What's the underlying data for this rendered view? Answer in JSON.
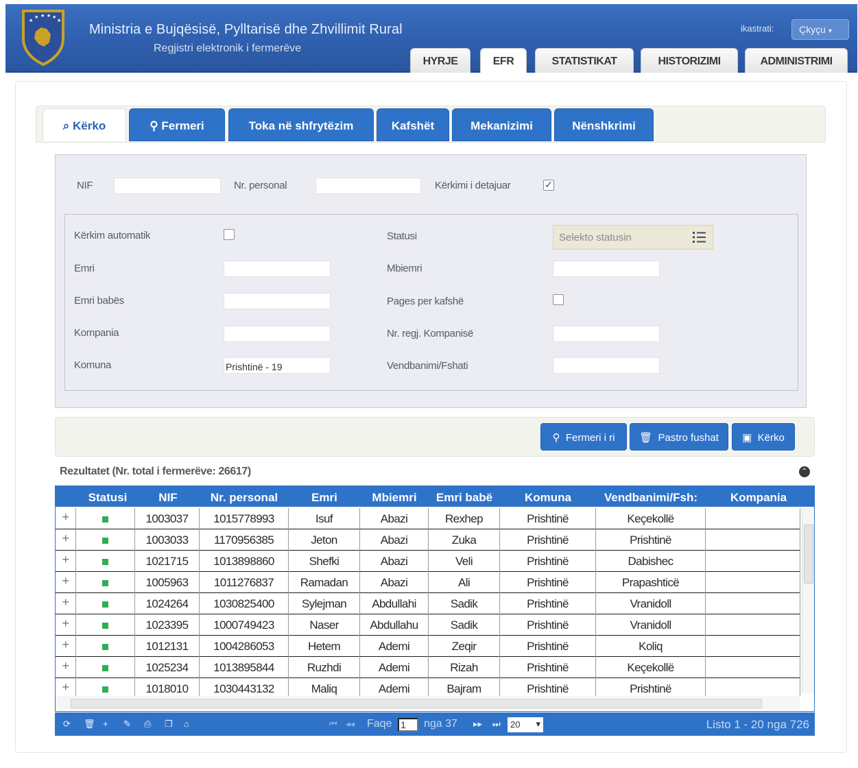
{
  "header": {
    "title": "Ministria e Bujqësisë, Pylltarisë dhe Zhvillimit Rural",
    "subtitle": "Regjistri elektronik i fermerëve",
    "user": "ikastrati:",
    "logout": "Çkyçu"
  },
  "main_tabs": [
    {
      "label": "HYRJE"
    },
    {
      "label": "EFR"
    },
    {
      "label": "STATISTIKAT"
    },
    {
      "label": "HISTORIZIMI"
    },
    {
      "label": "ADMINISTRIMI"
    }
  ],
  "sub_tabs": [
    {
      "label": "Kërko"
    },
    {
      "label": "Fermeri"
    },
    {
      "label": "Toka në shfrytëzim"
    },
    {
      "label": "Kafshët"
    },
    {
      "label": "Mekanizimi"
    },
    {
      "label": "Nënshkrimi"
    }
  ],
  "search": {
    "nif_label": "NIF",
    "nif_value": "",
    "personal_label": "Nr. personal",
    "personal_value": "",
    "detailed_label": "Kërkimi i detajuar",
    "detailed_checked": true,
    "auto_label": "Kërkim automatik",
    "auto_checked": false,
    "status_label": "Statusi",
    "status_placeholder": "Selekto statusin",
    "name_label": "Emri",
    "surname_label": "Mbiemri",
    "father_label": "Emri babës",
    "animal_pay_label": "Pages per kafshë",
    "animal_pay_checked": false,
    "company_label": "Kompania",
    "company_reg_label": "Nr. regj. Kompanisë",
    "municipality_label": "Komuna",
    "municipality_value": "Prishtinë - 19",
    "village_label": "Vendbanimi/Fshati"
  },
  "actions": {
    "new_farmer": "Fermeri i ri",
    "clear": "Pastro fushat",
    "search": "Kërko"
  },
  "results": {
    "title": "Rezultatet (Nr. total i fermerëve: 26617)",
    "columns": [
      "Statusi",
      "NIF",
      "Nr. personal",
      "Emri",
      "Mbiemri",
      "Emri babë",
      "Komuna",
      "Vendbanimi/Fsh:",
      "Kompania"
    ],
    "rows": [
      [
        "1003037",
        "1015778993",
        "Isuf",
        "Abazi",
        "Rexhep",
        "Prishtinë",
        "Keçekollë",
        ""
      ],
      [
        "1003033",
        "1170956385",
        "Jeton",
        "Abazi",
        "Zuka",
        "Prishtinë",
        "Prishtinë",
        ""
      ],
      [
        "1021715",
        "1013898860",
        "Shefki",
        "Abazi",
        "Veli",
        "Prishtinë",
        "Dabishec",
        ""
      ],
      [
        "1005963",
        "1011276837",
        "Ramadan",
        "Abazi",
        "Ali",
        "Prishtinë",
        "Prapashticë",
        ""
      ],
      [
        "1024264",
        "1030825400",
        "Sylejman",
        "Abdullahi",
        "Sadik",
        "Prishtinë",
        "Vranidoll",
        ""
      ],
      [
        "1023395",
        "1000749423",
        "Naser",
        "Abdullahu",
        "Sadik",
        "Prishtinë",
        "Vranidoll",
        ""
      ],
      [
        "1012131",
        "1004286053",
        "Hetem",
        "Ademi",
        "Zeqir",
        "Prishtinë",
        "Koliq",
        ""
      ],
      [
        "1025234",
        "1013895844",
        "Ruzhdi",
        "Ademi",
        "Rizah",
        "Prishtinë",
        "Keçekollë",
        ""
      ],
      [
        "1018010",
        "1030443132",
        "Maliq",
        "Ademi",
        "Bajram",
        "Prishtinë",
        "Prishtinë",
        ""
      ]
    ],
    "status_color": "#2fae55"
  },
  "pager": {
    "page_label": "Faqe",
    "page_value": "1",
    "of_label": "nga 37",
    "page_size": "20",
    "info": "Listo 1 - 20 nga 726"
  },
  "colors": {
    "header_blue": "#2f5fae",
    "accent_blue": "#2f73c9",
    "panel_bg": "#ececf3"
  }
}
